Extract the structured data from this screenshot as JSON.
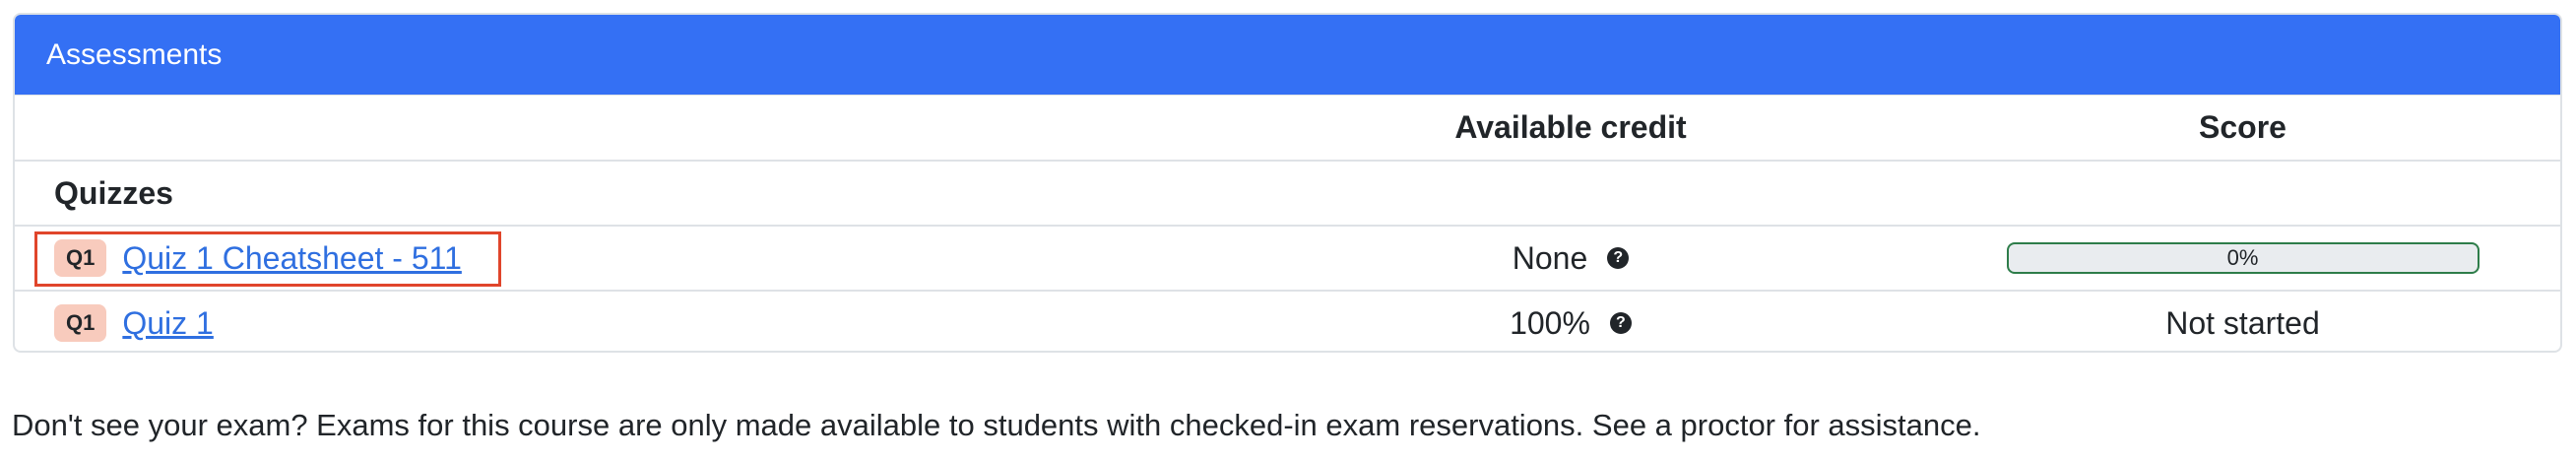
{
  "card": {
    "title": "Assessments"
  },
  "table": {
    "headers": {
      "credit": "Available credit",
      "score": "Score"
    },
    "section_label": "Quizzes",
    "rows": [
      {
        "badge": "Q1",
        "name": "Quiz 1 Cheatsheet - 511",
        "credit": "None",
        "score_progress_label": "0%",
        "score_progress_fraction": 0,
        "highlighted": true
      },
      {
        "badge": "Q1",
        "name": "Quiz 1",
        "credit": "100%",
        "score_text": "Not started",
        "highlighted": false
      }
    ]
  },
  "help_icon_glyph": "?",
  "footer_note": "Don't see your exam? Exams for this course are only made available to students with checked-in exam reservations. See a proctor for assistance.",
  "colors": {
    "header_bg": "#3470f4",
    "badge_bg": "#f8cbbd",
    "link": "#2f6fe0",
    "highlight_border": "#e0452b",
    "progress_border": "#2e7d4a"
  }
}
